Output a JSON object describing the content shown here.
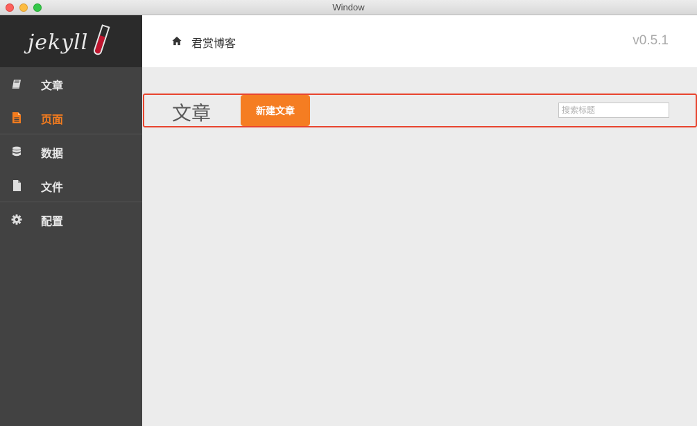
{
  "window": {
    "title": "Window"
  },
  "sidebar": {
    "logo": {
      "text": "jekyll"
    },
    "items": [
      {
        "label": "文章",
        "icon": "book-icon",
        "active": false
      },
      {
        "label": "页面",
        "icon": "file-text-icon",
        "active": true
      },
      {
        "label": "数据",
        "icon": "database-icon",
        "active": false
      },
      {
        "label": "文件",
        "icon": "file-icon",
        "active": false
      },
      {
        "label": "配置",
        "icon": "gear-icon",
        "active": false
      }
    ]
  },
  "header": {
    "breadcrumb": "君赏博客",
    "version": "v0.5.1"
  },
  "main": {
    "title": "文章",
    "new_button_label": "新建文章",
    "search": {
      "placeholder": "搜索标题",
      "value": ""
    }
  },
  "colors": {
    "accent": "#f57d22",
    "highlight_border": "#e8442e",
    "sidebar_bg": "#424242",
    "logo_bg": "#2b2b2b"
  }
}
